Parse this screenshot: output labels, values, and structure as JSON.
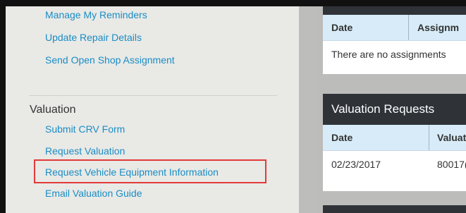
{
  "sidebar": {
    "links_top": [
      {
        "label": "Manage My Reminders"
      },
      {
        "label": "Update Repair Details"
      },
      {
        "label": "Send Open Shop Assignment"
      }
    ],
    "valuation": {
      "title": "Valuation",
      "links": [
        {
          "label": "Submit CRV Form"
        },
        {
          "label": "Request Valuation"
        },
        {
          "label": "Request Vehicle Equipment Information",
          "highlighted": true
        },
        {
          "label": "Email Valuation Guide"
        }
      ]
    }
  },
  "assignments": {
    "columns": [
      "Date",
      "Assignm"
    ],
    "empty_message": "There are no assignments"
  },
  "valuation_requests": {
    "title": "Valuation Requests",
    "columns": [
      "Date",
      "Valuat"
    ],
    "rows": [
      {
        "date": "02/23/2017",
        "valuation": "80017("
      }
    ]
  },
  "colors": {
    "link": "#1a8dc4",
    "highlight_border": "#e23a3a",
    "table_header_bg": "#d7ecf8",
    "card_header_bg": "#2f3338"
  }
}
